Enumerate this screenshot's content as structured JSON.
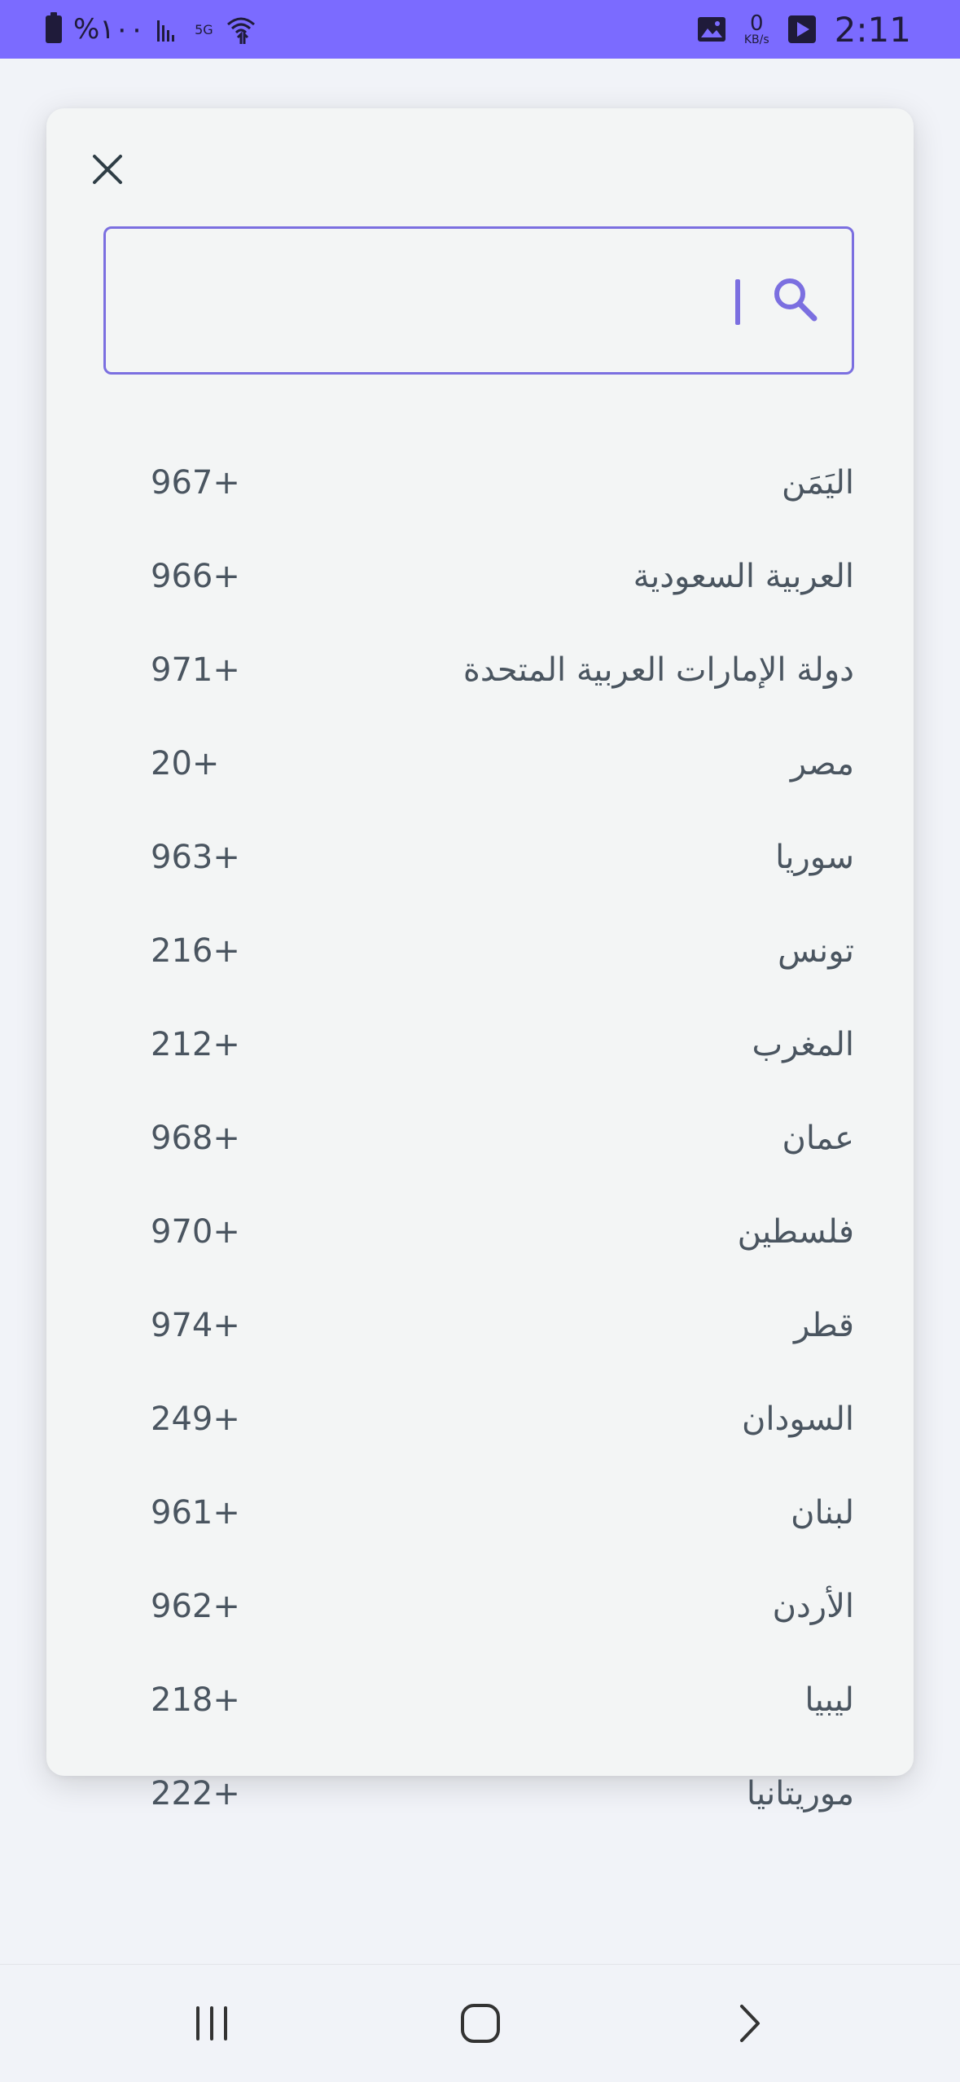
{
  "status_bar": {
    "battery_text": "%١٠٠",
    "network_label": "5G",
    "data_speed_value": "0",
    "data_speed_unit": "KB/s",
    "time": "2:11"
  },
  "search": {
    "placeholder": "",
    "value": ""
  },
  "countries": [
    {
      "name": "اليَمَن",
      "code": "+967"
    },
    {
      "name": "العربية السعودية",
      "code": "+966"
    },
    {
      "name": "دولة الإمارات العربية المتحدة",
      "code": "+971"
    },
    {
      "name": "مصر",
      "code": "+20"
    },
    {
      "name": "سوريا",
      "code": "+963"
    },
    {
      "name": "تونس",
      "code": "+216"
    },
    {
      "name": "المغرب",
      "code": "+212"
    },
    {
      "name": "عمان",
      "code": "+968"
    },
    {
      "name": "فلسطين",
      "code": "+970"
    },
    {
      "name": "قطر",
      "code": "+974"
    },
    {
      "name": "السودان",
      "code": "+249"
    },
    {
      "name": "لبنان",
      "code": "+961"
    },
    {
      "name": "الأردن",
      "code": "+962"
    },
    {
      "name": "ليبيا",
      "code": "+218"
    },
    {
      "name": "موريتانيا",
      "code": "+222"
    }
  ],
  "icons": {
    "close": "close-icon",
    "search": "search-icon",
    "recents": "recents-icon",
    "home": "home-icon",
    "back": "back-icon"
  },
  "colors": {
    "status_bar": "#7b6bff",
    "accent": "#7b6fe0",
    "card": "#f3f5f5",
    "text": "#4a5560"
  }
}
